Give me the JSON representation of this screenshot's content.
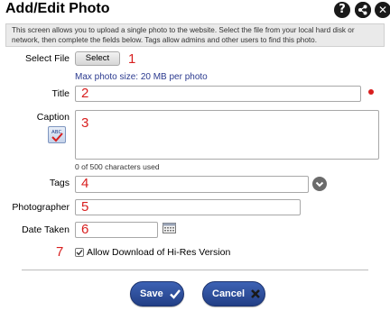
{
  "dialog": {
    "title": "Add/Edit Photo",
    "help_icon": "question-mark-icon",
    "share_icon": "share-nodes-icon",
    "close_icon": "close-icon"
  },
  "intro": "This screen allows you to upload a single photo to the website. Select the file from your local hard disk or network, then complete the fields below. Tags allow admins and other users to find this photo.",
  "form": {
    "select_file_label": "Select File",
    "select_button": "Select",
    "max_size_note": "Max photo size: 20 MB per photo",
    "title_label": "Title",
    "caption_label": "Caption",
    "char_count": "0 of 500 characters used",
    "tags_label": "Tags",
    "photographer_label": "Photographer",
    "date_taken_label": "Date Taken",
    "allow_download_label": "Allow Download of Hi-Res Version",
    "allow_download_checked": true
  },
  "annotations": [
    "1",
    "2",
    "3",
    "4",
    "5",
    "6",
    "7"
  ],
  "buttons": {
    "save": "Save",
    "cancel": "Cancel"
  },
  "colors": {
    "button_blue": "#2f51a3",
    "annotation_red": "#d81e1e",
    "link_blue": "#2b3a8f"
  }
}
